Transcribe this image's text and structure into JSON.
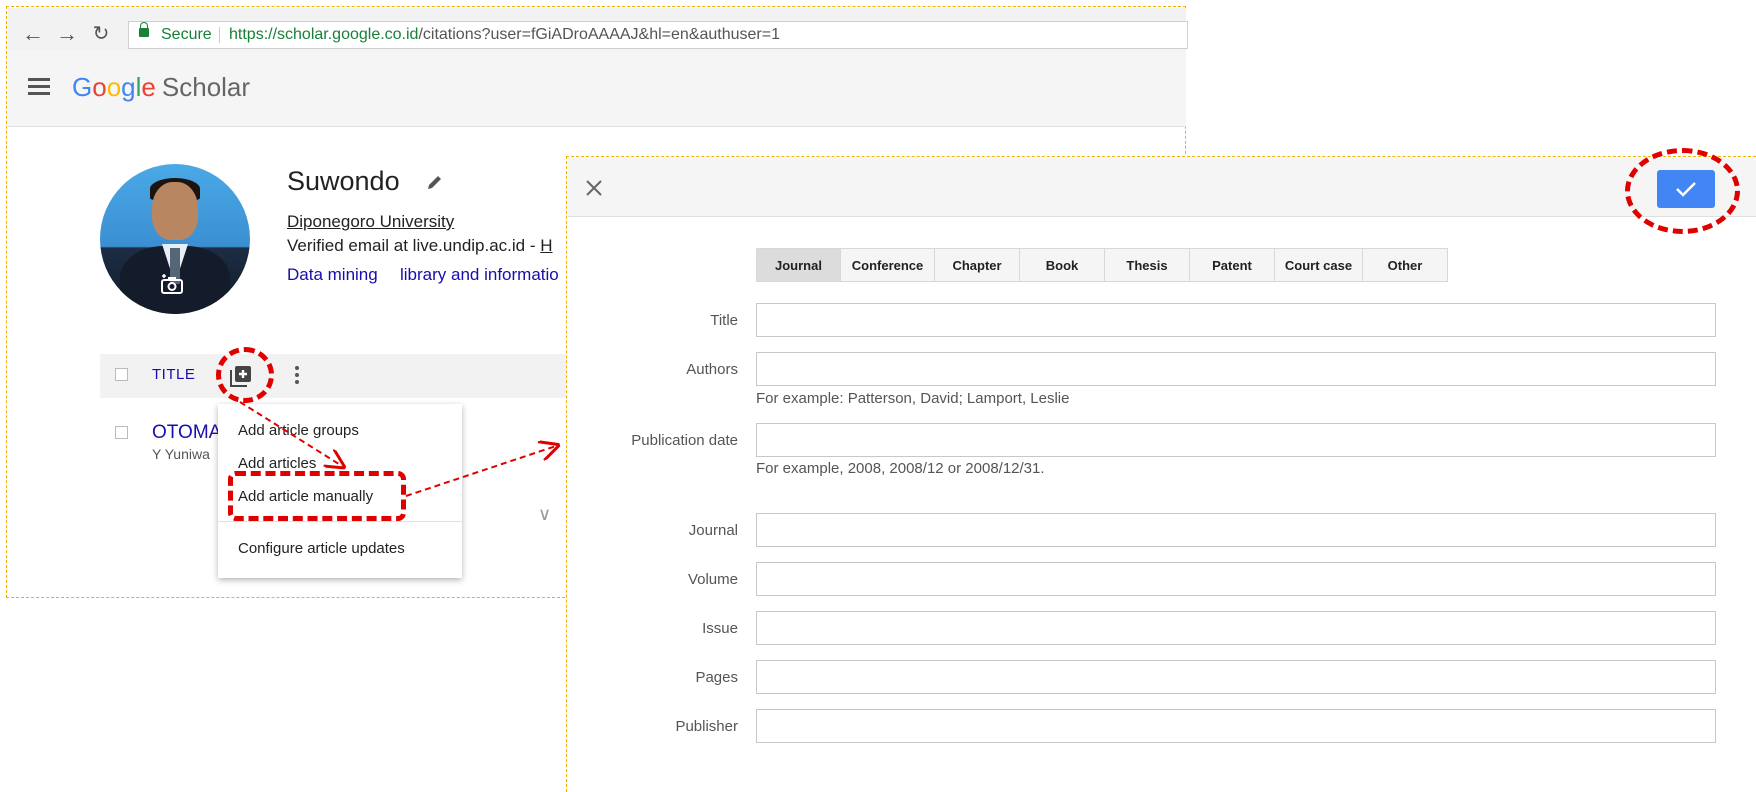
{
  "browser": {
    "secure_label": "Secure",
    "url_host": "https://scholar.google.co.id",
    "url_rest": "/citations?user=fGiADroAAAAJ&hl=en&authuser=1"
  },
  "header": {
    "logo_letters": [
      "G",
      "o",
      "o",
      "g",
      "l",
      "e"
    ],
    "logo_suffix": "Scholar"
  },
  "profile": {
    "name": "Suwondo",
    "affiliation": "Diponegoro University",
    "email_prefix": "Verified email at live.undip.ac.id - ",
    "email_link": "H",
    "interests": [
      "Data mining",
      "library and informatio"
    ]
  },
  "articles": {
    "title_header": "TITLE",
    "rows": [
      {
        "title": "OTOMA",
        "authors": "Y Yuniwa"
      }
    ]
  },
  "add_menu": {
    "items": [
      "Add article groups",
      "Add articles",
      "Add article manually",
      "Configure article updates"
    ]
  },
  "dialog": {
    "types": [
      "Journal",
      "Conference",
      "Chapter",
      "Book",
      "Thesis",
      "Patent",
      "Court case",
      "Other"
    ],
    "fields": {
      "title": {
        "label": "Title",
        "value": ""
      },
      "authors": {
        "label": "Authors",
        "value": "",
        "help": "For example: Patterson, David; Lamport, Leslie"
      },
      "publication_date": {
        "label": "Publication date",
        "value": "",
        "help": "For example, 2008, 2008/12 or 2008/12/31."
      },
      "journal": {
        "label": "Journal",
        "value": ""
      },
      "volume": {
        "label": "Volume",
        "value": ""
      },
      "issue": {
        "label": "Issue",
        "value": ""
      },
      "pages": {
        "label": "Pages",
        "value": ""
      },
      "publisher": {
        "label": "Publisher",
        "value": ""
      }
    }
  },
  "colors": {
    "accent_blue": "#4285f4",
    "link_blue": "#1a0dab",
    "annotation_red": "#e00000",
    "frame_yellow": "#f0b400",
    "secure_green": "#188038"
  }
}
